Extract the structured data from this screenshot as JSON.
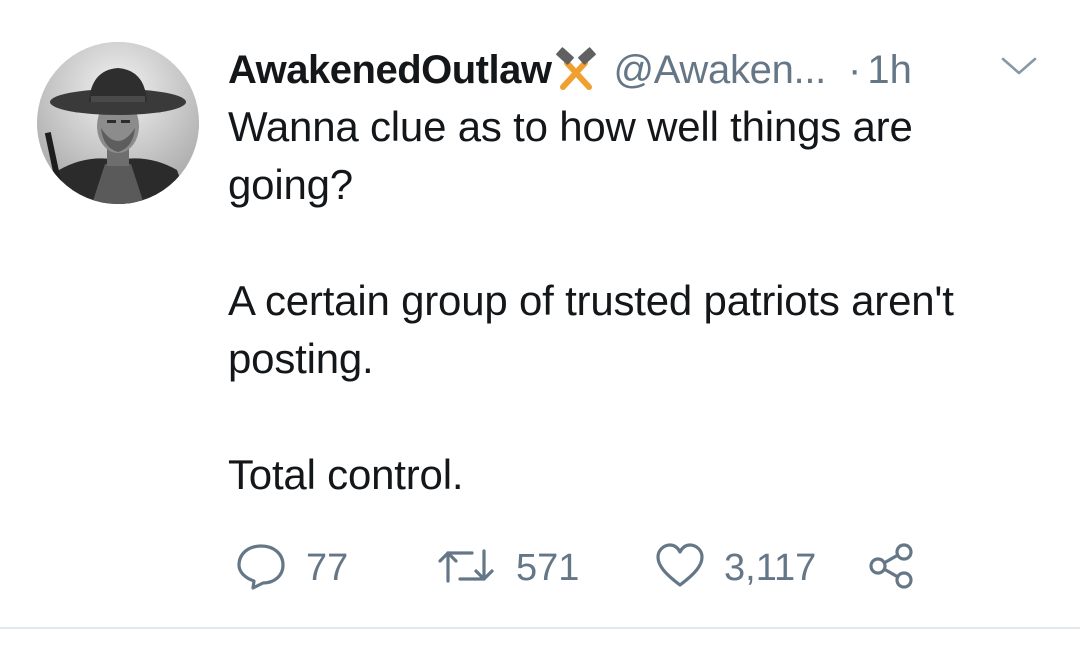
{
  "tweet": {
    "display_name": "AwakenedOutlaw",
    "badge_icon": "crossed-hammers-icon",
    "handle": "@Awaken...",
    "separator": "·",
    "time": "1h",
    "paragraphs": [
      "Wanna clue as to how well things are going?",
      "A certain group of trusted patriots aren't posting.",
      "Total control."
    ],
    "actions": {
      "reply_count": "77",
      "retweet_count": "571",
      "like_count": "3,117"
    }
  },
  "colors": {
    "text": "#14171a",
    "muted": "#657786",
    "badge": "#f0a030",
    "divider": "#e1e8ed"
  }
}
